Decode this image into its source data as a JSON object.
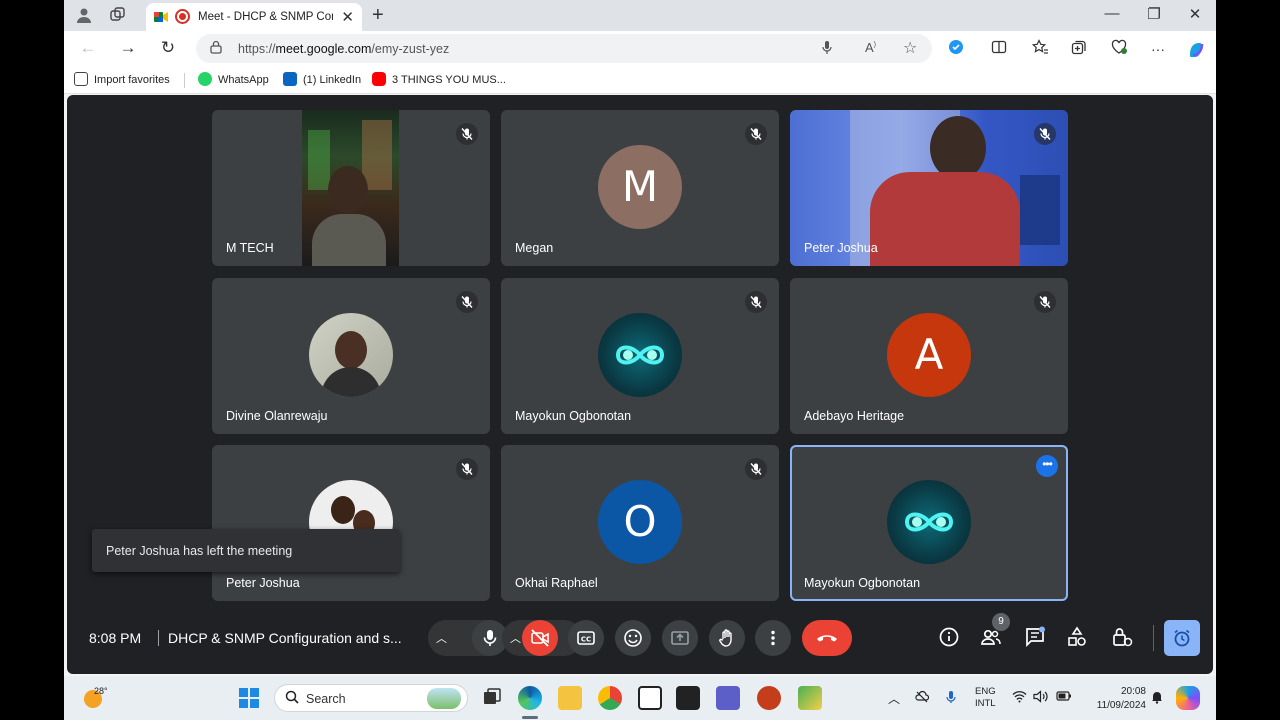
{
  "browser": {
    "tab_title": "Meet - DHCP & SNMP Configuration and setup",
    "url_prefix": "https://",
    "url_host": "meet.google.com",
    "url_path": "/emy-zust-yez",
    "bookmarks": [
      {
        "label": "Import favorites",
        "color": "#f0f0f0"
      },
      {
        "label": "WhatsApp",
        "color": "#25d366"
      },
      {
        "label": "(1) LinkedIn",
        "color": "#0a66c2"
      },
      {
        "label": "3 THINGS YOU MUS...",
        "color": "#ff0000"
      }
    ]
  },
  "meeting": {
    "time": "8:08 PM",
    "title": "DHCP & SNMP Configuration and s...",
    "participant_count": "9",
    "toast": "Peter Joshua has left the meeting",
    "participants": [
      {
        "name": "M TECH",
        "kind": "video"
      },
      {
        "name": "Megan",
        "kind": "letter",
        "letter": "M",
        "color": "#8d6e63"
      },
      {
        "name": "Peter Joshua",
        "kind": "video"
      },
      {
        "name": "Divine Olanrewaju",
        "kind": "photo"
      },
      {
        "name": "Mayokun Ogbonotan",
        "kind": "infinity"
      },
      {
        "name": "Adebayo Heritage",
        "kind": "letter",
        "letter": "A",
        "color": "#c6370e"
      },
      {
        "name": "Peter Joshua",
        "kind": "photo"
      },
      {
        "name": "Okhai Raphael",
        "kind": "letter",
        "letter": "O",
        "color": "#0b57a6"
      },
      {
        "name": "Mayokun Ogbonotan",
        "kind": "infinity"
      }
    ]
  },
  "taskbar": {
    "temperature": "28°",
    "search_label": "Search",
    "lang_line1": "ENG",
    "lang_line2": "INTL",
    "clock_time": "20:08",
    "clock_date": "11/09/2024"
  }
}
